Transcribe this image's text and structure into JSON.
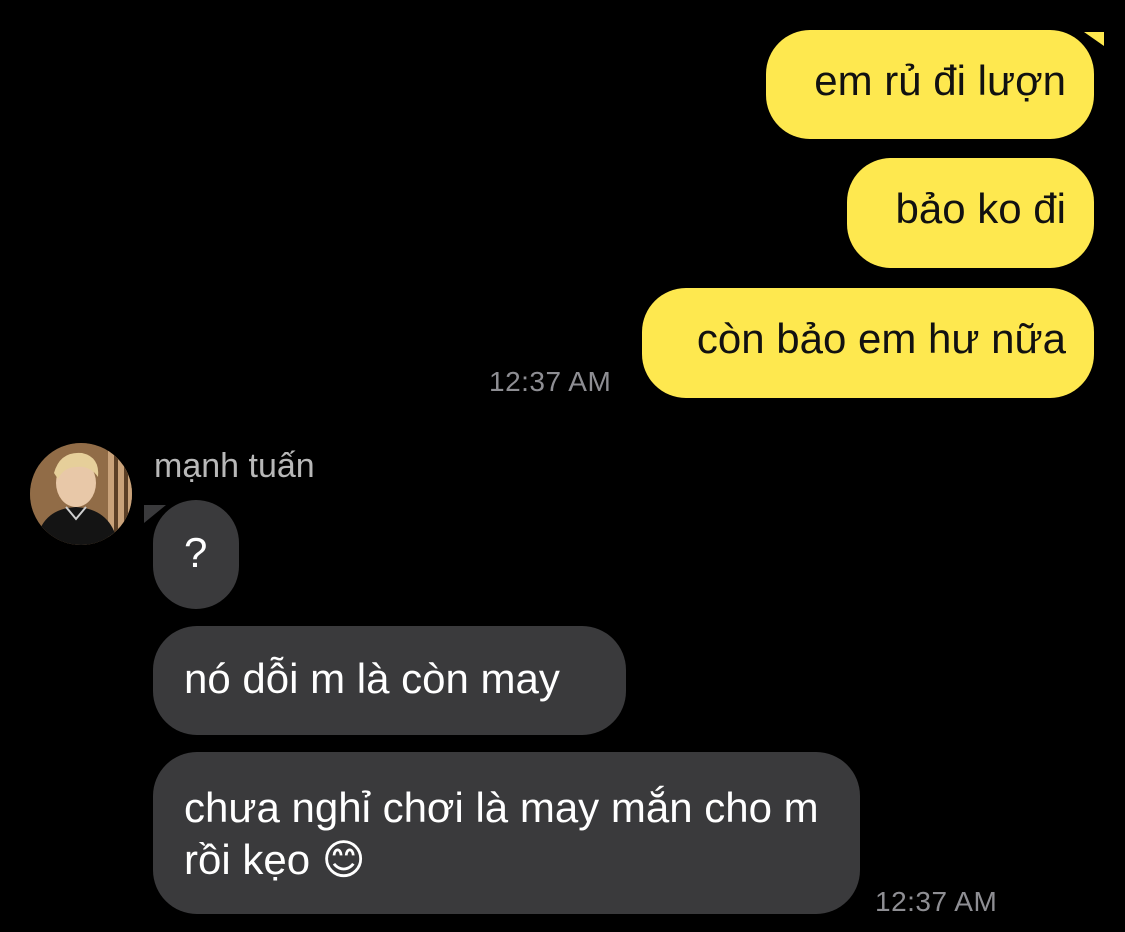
{
  "outgoing": {
    "messages": [
      {
        "text": "em rủ đi lượn"
      },
      {
        "text": "bảo ko đi"
      },
      {
        "text": "còn bảo em hư nữa"
      }
    ],
    "timestamp": "12:37 AM",
    "bubble_color": "#fee84f"
  },
  "incoming": {
    "sender_name": "mạnh tuấn",
    "avatar": "profile-photo",
    "messages": [
      {
        "text": "?"
      },
      {
        "text": "nó dỗi m là còn may"
      },
      {
        "text": "chưa nghỉ chơi là may mắn cho m rồi kẹo",
        "emoji": "😊"
      }
    ],
    "timestamp": "12:37 AM",
    "bubble_color": "#3a3a3c"
  }
}
